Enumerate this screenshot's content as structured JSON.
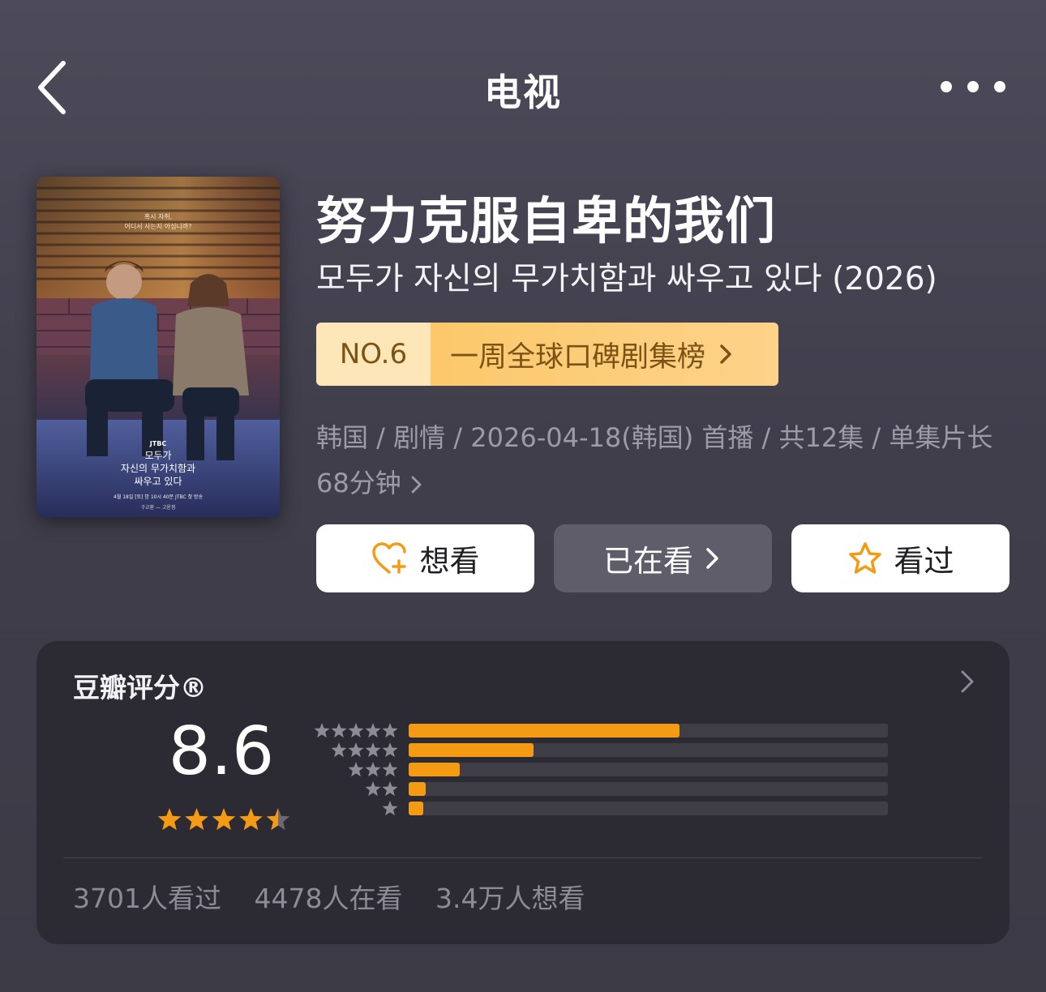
{
  "header": {
    "title": "电视"
  },
  "show": {
    "title": "努力克服自卑的我们",
    "subtitle": "모두가 자신의 무가치함과 싸우고 있다 (2026)",
    "rank": {
      "number": "NO.6",
      "list_name": "一周全球口碑剧集榜"
    },
    "meta_line1": "韩国 / 剧情 / 2026-04-18(韩国) 首播 / 共12集 / 单集片长",
    "meta_line2": "68分钟"
  },
  "poster": {
    "tagline_line1": "혹시 자취,",
    "tagline_line2": "어디서 사는지 아십니까?",
    "channel": "JTBC",
    "title_lines": [
      "모두가",
      "자신의 무가치함과",
      "싸우고 있다"
    ],
    "airing": "4월 18일 [토] 밤 10시 40분 JTBC 첫 방송",
    "cast": "구교환 — 고윤정"
  },
  "actions": {
    "want": "想看",
    "watching": "已在看",
    "watched": "看过"
  },
  "rating": {
    "title": "豆瓣评分®",
    "score": "8.6",
    "score_stars": 4.5,
    "distribution": [
      {
        "stars": 5,
        "fraction": 0.565
      },
      {
        "stars": 4,
        "fraction": 0.26
      },
      {
        "stars": 3,
        "fraction": 0.107
      },
      {
        "stars": 2,
        "fraction": 0.035
      },
      {
        "stars": 1,
        "fraction": 0.03
      }
    ]
  },
  "stats": {
    "watched": "3701人看过",
    "watching": "4478人在看",
    "want": "3.4万人想看"
  },
  "colors": {
    "accent": "#f59a13",
    "rank_bg": "#fcc86a",
    "rank_text": "#7c5316",
    "card_bg": "#2c2b33"
  },
  "icons": [
    "back-chevron-icon",
    "more-dots-icon",
    "heart-plus-icon",
    "star-outline-icon",
    "chevron-right-icon",
    "star-icon"
  ]
}
